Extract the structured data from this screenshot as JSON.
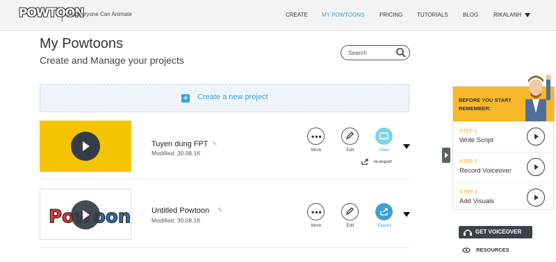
{
  "header": {
    "logo": "POWTOON",
    "tagline": "So Everyone Can Animate",
    "nav": [
      "CREATE",
      "MY POWTOONS",
      "PRICING",
      "TUTORIALS",
      "BLOG",
      "RIKALANH"
    ]
  },
  "page": {
    "title": "My Powtoons",
    "subtitle": "Create and Manage your projects",
    "search_placeholder": "Search"
  },
  "create": {
    "label": "Create a new project"
  },
  "projects": [
    {
      "title": "Tuyen dung FPT",
      "modified": "Modified: 30.08.16",
      "actions": [
        "More",
        "Edit",
        "View"
      ],
      "extra": "re-export",
      "thumb_color": "#f5c400"
    },
    {
      "title": "Untitled Powtoon",
      "modified": "Modified: 30.08.16",
      "actions": [
        "More",
        "Edit",
        "Export"
      ],
      "thumb_color": "#ffffff"
    }
  ],
  "panel": {
    "heading1": "BEFORE YOU START",
    "heading2": "REMEMBER:",
    "steps": [
      {
        "num": "STEP 1",
        "text": "Write Script"
      },
      {
        "num": "STEP 2",
        "text": "Record Voiceover"
      },
      {
        "num": "STEP 3",
        "text": "Add Visuals"
      }
    ],
    "voiceover_button": "GET VOICEOVER",
    "resources": "RESOURCES"
  },
  "colors": {
    "accent": "#3fa1d4",
    "panel_head": "#f8b829",
    "step_num": "#f0a92d"
  }
}
